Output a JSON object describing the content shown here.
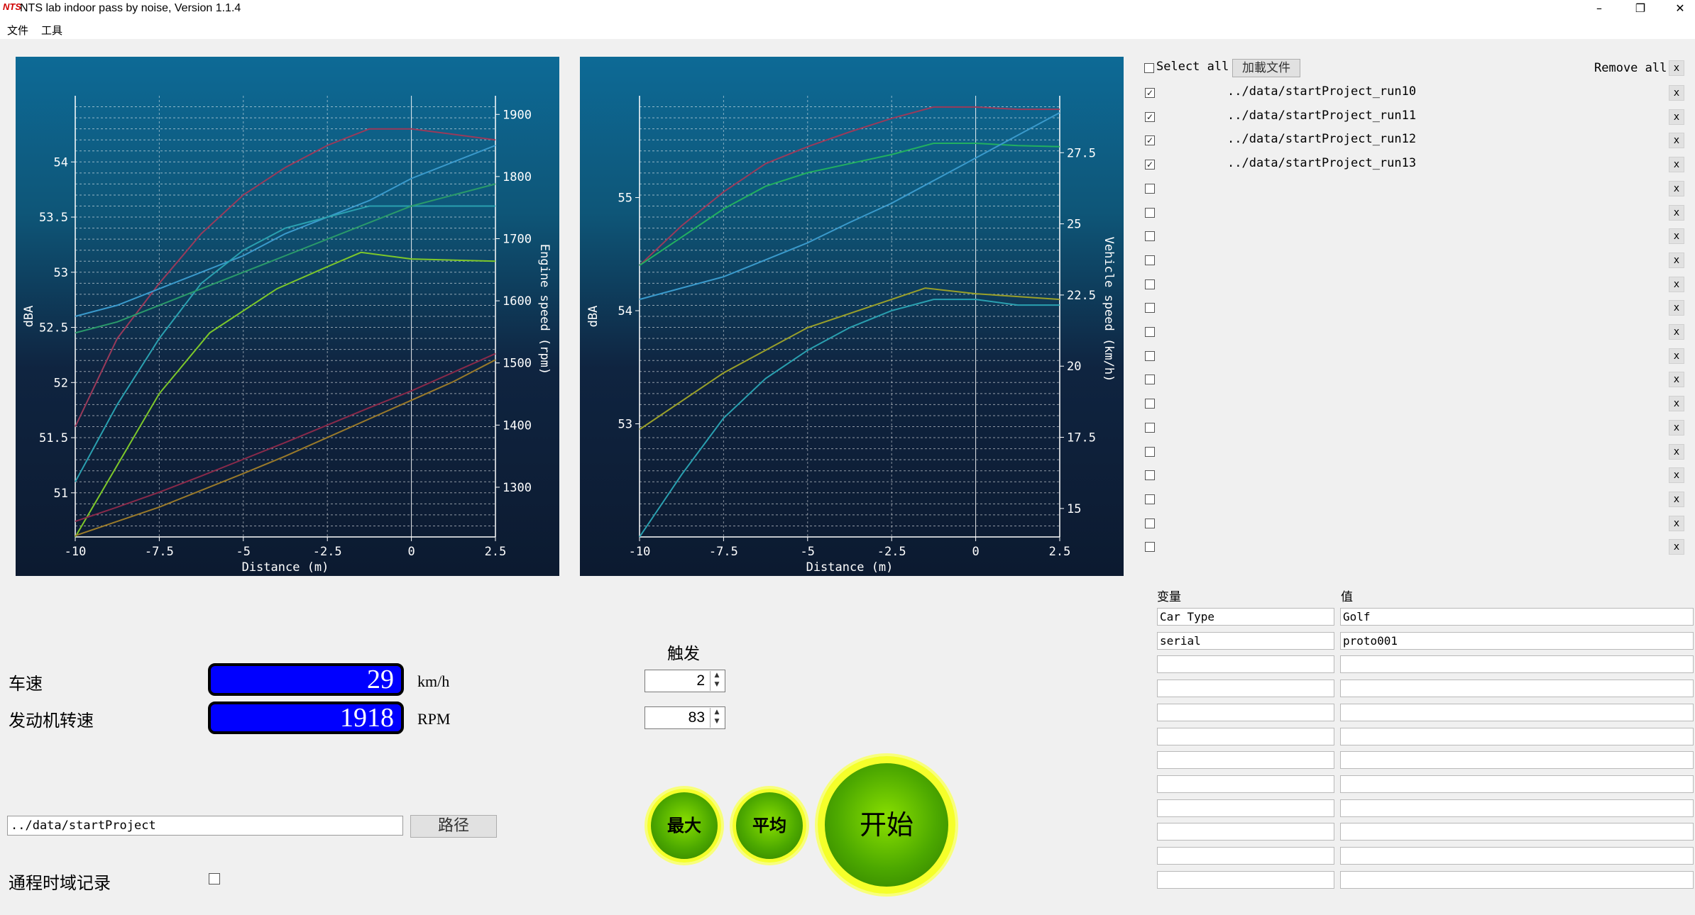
{
  "window": {
    "logo": "NTS",
    "title": "NTS lab indoor pass by noise, Version 1.1.4",
    "minimize": "–",
    "restore": "❐",
    "close": "✕"
  },
  "menu": {
    "file": "文件",
    "tools": "工具"
  },
  "chart_data": [
    {
      "type": "line",
      "xlabel": "Distance (m)",
      "ylabel": "dBA",
      "y2label": "Engine speed (rpm)",
      "xlim": [
        -10,
        2.5
      ],
      "ylim": [
        50.6,
        54.6
      ],
      "y2lim": [
        1220,
        1930
      ],
      "x_ticks": [
        -10,
        -7.5,
        -5,
        -2.5,
        0,
        2.5
      ],
      "y_ticks": [
        51,
        51.5,
        52,
        52.5,
        53,
        53.5,
        54
      ],
      "y2_ticks": [
        1300,
        1400,
        1500,
        1600,
        1700,
        1800,
        1900
      ],
      "grid": true,
      "series": [
        {
          "axis": "left",
          "color": "#9a3a5a",
          "x": [
            -10,
            -8.75,
            -7.5,
            -6.25,
            -5,
            -3.75,
            -2.5,
            -1.25,
            0,
            1.25,
            2.5
          ],
          "y": [
            51.6,
            52.4,
            52.9,
            53.35,
            53.7,
            53.95,
            54.15,
            54.3,
            54.3,
            54.25,
            54.2
          ]
        },
        {
          "axis": "left",
          "color": "#3a9acc",
          "x": [
            -10,
            -8.75,
            -7.5,
            -6.25,
            -5,
            -3.75,
            -2.5,
            -1.25,
            0,
            1.25,
            2.5
          ],
          "y": [
            52.6,
            52.7,
            52.85,
            53.0,
            53.15,
            53.35,
            53.5,
            53.65,
            53.85,
            54.0,
            54.15
          ]
        },
        {
          "axis": "left",
          "color": "#2aa0b0",
          "x": [
            -10,
            -8.75,
            -7.5,
            -6.25,
            -5,
            -3.75,
            -2.5,
            -1.25,
            0,
            1.25,
            2.5
          ],
          "y": [
            51.1,
            51.8,
            52.4,
            52.9,
            53.2,
            53.4,
            53.5,
            53.6,
            53.6,
            53.6,
            53.6
          ]
        },
        {
          "axis": "left",
          "color": "#2a9a6a",
          "x": [
            -10,
            -8.75,
            -7.5,
            -6.25,
            -5,
            -3.75,
            -2.5,
            -1.25,
            0,
            1.25,
            2.5
          ],
          "y": [
            52.45,
            52.55,
            52.7,
            52.85,
            53.0,
            53.15,
            53.3,
            53.45,
            53.6,
            53.7,
            53.8
          ]
        },
        {
          "axis": "left",
          "color": "#7ec82a",
          "x": [
            -10,
            -7.5,
            -6,
            -4,
            -2.5,
            -1.5,
            0,
            2.5
          ],
          "y": [
            50.6,
            51.9,
            52.45,
            52.85,
            53.05,
            53.18,
            53.12,
            53.1
          ]
        },
        {
          "axis": "right",
          "color": "#8a2a4a",
          "x": [
            -10,
            -8.75,
            -7.5,
            -6.25,
            -5,
            -3.75,
            -2.5,
            -1.25,
            0,
            1.25,
            2.5
          ],
          "y": [
            1245,
            1268,
            1292,
            1318,
            1345,
            1372,
            1400,
            1428,
            1455,
            1485,
            1515
          ]
        },
        {
          "axis": "right",
          "color": "#9a7a2a",
          "x": [
            -10,
            -8.75,
            -7.5,
            -6.25,
            -5,
            -3.75,
            -2.5,
            -1.25,
            0,
            1.25,
            2.5
          ],
          "y": [
            1222,
            1245,
            1268,
            1295,
            1322,
            1350,
            1380,
            1410,
            1440,
            1470,
            1505
          ]
        }
      ]
    },
    {
      "type": "line",
      "xlabel": "Distance (m)",
      "ylabel": "dBA",
      "y2label": "Vehicle speed (km/h)",
      "xlim": [
        -10,
        2.5
      ],
      "ylim": [
        52.0,
        55.9
      ],
      "y2lim": [
        14.0,
        29.5
      ],
      "x_ticks": [
        -10,
        -7.5,
        -5,
        -2.5,
        0,
        2.5
      ],
      "y_ticks": [
        53,
        54,
        55
      ],
      "y2_ticks": [
        15,
        17.5,
        20,
        22.5,
        25,
        27.5
      ],
      "grid": true,
      "series": [
        {
          "axis": "left",
          "color": "#9a3a5a",
          "x": [
            -10,
            -8.75,
            -7.5,
            -6.25,
            -5,
            -3.75,
            -2.5,
            -1.25,
            0,
            1.25,
            2.5
          ],
          "y": [
            54.4,
            54.75,
            55.05,
            55.3,
            55.45,
            55.58,
            55.7,
            55.8,
            55.8,
            55.78,
            55.78
          ]
        },
        {
          "axis": "left",
          "color": "#22b060",
          "x": [
            -10,
            -8.75,
            -7.5,
            -6.25,
            -5,
            -3.75,
            -2.5,
            -1.25,
            0,
            1.25,
            2.5
          ],
          "y": [
            54.4,
            54.65,
            54.9,
            55.1,
            55.22,
            55.3,
            55.38,
            55.48,
            55.48,
            55.46,
            55.45
          ]
        },
        {
          "axis": "left",
          "color": "#3a9acc",
          "x": [
            -10,
            -8.75,
            -7.5,
            -6.25,
            -5,
            -3.75,
            -2.5,
            -1.25,
            0,
            1.25,
            2.5
          ],
          "y": [
            54.1,
            54.2,
            54.3,
            54.45,
            54.6,
            54.78,
            54.95,
            55.15,
            55.35,
            55.55,
            55.75
          ]
        },
        {
          "axis": "left",
          "color": "#9aa02a",
          "x": [
            -10,
            -7.5,
            -5,
            -2.5,
            -1.5,
            0,
            2.5
          ],
          "y": [
            52.95,
            53.45,
            53.85,
            54.1,
            54.2,
            54.15,
            54.1
          ]
        },
        {
          "axis": "left",
          "color": "#2aa0b0",
          "x": [
            -10,
            -8.75,
            -7.5,
            -6.25,
            -5,
            -3.75,
            -2.5,
            -1.25,
            0,
            1.25,
            2.5
          ],
          "y": [
            52.0,
            52.55,
            53.05,
            53.4,
            53.65,
            53.85,
            54.0,
            54.1,
            54.1,
            54.05,
            54.05
          ]
        }
      ]
    }
  ],
  "file_list": {
    "select_all_label": "Select all",
    "load_button": "加載文件",
    "remove_all_label": "Remove all",
    "remove_glyph": "x",
    "check_glyph": "✓",
    "items": [
      {
        "checked": true,
        "path": "../data/startProject_run10"
      },
      {
        "checked": true,
        "path": "../data/startProject_run11"
      },
      {
        "checked": true,
        "path": "../data/startProject_run12"
      },
      {
        "checked": true,
        "path": "../data/startProject_run13"
      },
      {
        "checked": false,
        "path": ""
      },
      {
        "checked": false,
        "path": ""
      },
      {
        "checked": false,
        "path": ""
      },
      {
        "checked": false,
        "path": ""
      },
      {
        "checked": false,
        "path": ""
      },
      {
        "checked": false,
        "path": ""
      },
      {
        "checked": false,
        "path": ""
      },
      {
        "checked": false,
        "path": ""
      },
      {
        "checked": false,
        "path": ""
      },
      {
        "checked": false,
        "path": ""
      },
      {
        "checked": false,
        "path": ""
      },
      {
        "checked": false,
        "path": ""
      },
      {
        "checked": false,
        "path": ""
      },
      {
        "checked": false,
        "path": ""
      },
      {
        "checked": false,
        "path": ""
      },
      {
        "checked": false,
        "path": ""
      }
    ]
  },
  "variables": {
    "header_var": "变量",
    "header_val": "值",
    "rows": [
      {
        "var": "Car Type",
        "val": "Golf"
      },
      {
        "var": "serial",
        "val": "proto001"
      },
      {
        "var": "",
        "val": ""
      },
      {
        "var": "",
        "val": ""
      },
      {
        "var": "",
        "val": ""
      },
      {
        "var": "",
        "val": ""
      },
      {
        "var": "",
        "val": ""
      },
      {
        "var": "",
        "val": ""
      },
      {
        "var": "",
        "val": ""
      },
      {
        "var": "",
        "val": ""
      },
      {
        "var": "",
        "val": ""
      },
      {
        "var": "",
        "val": ""
      }
    ]
  },
  "readouts": {
    "speed_label": "车速",
    "speed_value": "29",
    "speed_unit": "km/h",
    "rpm_label": "发动机转速",
    "rpm_value": "1918",
    "rpm_unit": "RPM",
    "lcd_color": "#0000ff"
  },
  "trigger": {
    "label": "触发",
    "speed_trigger": "2",
    "rpm_trigger": "83"
  },
  "path": {
    "value": "../data/startProject",
    "button": "路径"
  },
  "record": {
    "label": "通程时域记录",
    "checked": false
  },
  "actions": {
    "max": "最大",
    "average": "平均",
    "start": "开始",
    "button_color": "#4ca800",
    "ring_color": "#f5ff2a"
  }
}
